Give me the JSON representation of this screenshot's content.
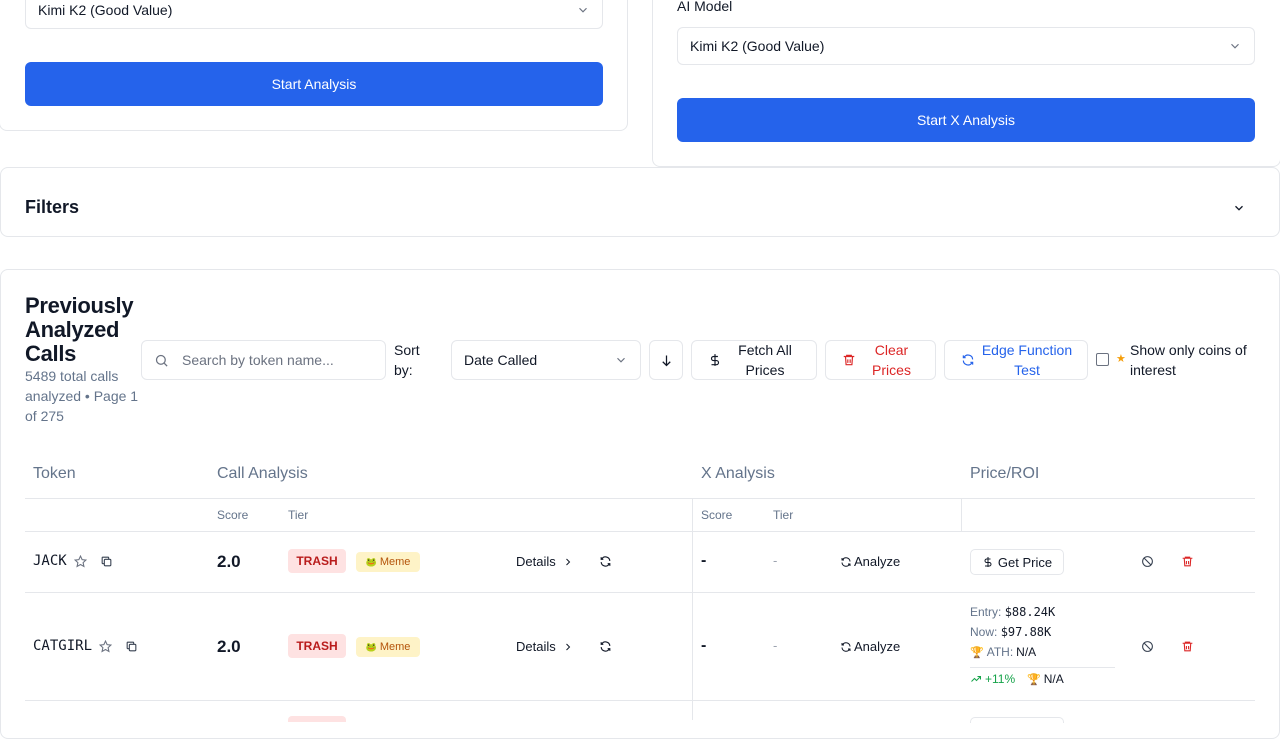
{
  "left_panel": {
    "model_value": "Kimi K2 (Good Value)",
    "start_label": "Start Analysis"
  },
  "right_panel": {
    "model_label": "AI Model",
    "model_value": "Kimi K2 (Good Value)",
    "start_label": "Start X Analysis"
  },
  "filters": {
    "title": "Filters"
  },
  "calls": {
    "title": "Previously Analyzed Calls",
    "subtitle": "5489 total calls analyzed • Page 1 of 275",
    "search_placeholder": "Search by token name...",
    "sort_label": "Sort by:",
    "sort_value": "Date Called",
    "fetch_label": "Fetch All Prices",
    "clear_label": "Clear Prices",
    "edge_label": "Edge Function Test",
    "interest_label": "Show only coins of interest"
  },
  "table": {
    "headers": {
      "token": "Token",
      "call": "Call Analysis",
      "x": "X Analysis",
      "price": "Price/ROI"
    },
    "sub": {
      "score": "Score",
      "tier": "Tier",
      "xscore": "Score",
      "xtier": "Tier"
    },
    "rows": [
      {
        "token": "JACK",
        "score": "2.0",
        "tier": "TRASH",
        "category": "Meme",
        "details": "Details",
        "x_score": "-",
        "x_tier": "-",
        "analyze": "Analyze",
        "get_price": "Get Price"
      },
      {
        "token": "CATGIRL",
        "score": "2.0",
        "tier": "TRASH",
        "category": "Meme",
        "details": "Details",
        "x_score": "-",
        "x_tier": "-",
        "analyze": "Analyze",
        "entry_label": "Entry:",
        "entry": "$88.24K",
        "now_label": "Now:",
        "now": "$97.88K",
        "ath_label": "ATH:",
        "ath": "N/A",
        "roi": "+11%",
        "ath_roi": "N/A"
      }
    ]
  },
  "colors": {
    "primary": "#2563eb",
    "danger": "#dc2626",
    "trash_bg": "#fee2e2",
    "meme_bg": "#fef3c7",
    "success": "#16a34a"
  }
}
